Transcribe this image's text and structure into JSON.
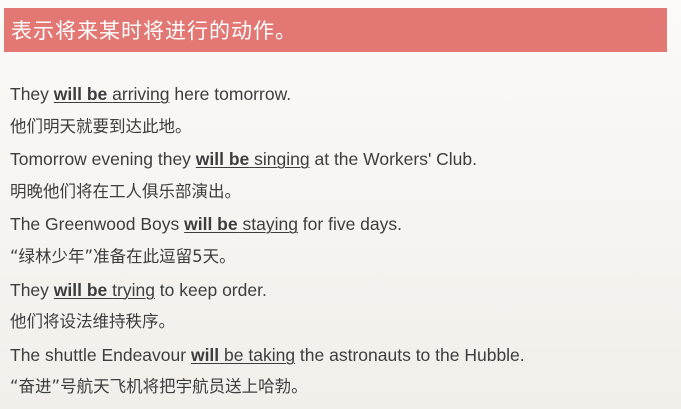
{
  "header": {
    "title": "表示将来某时将进行的动作。"
  },
  "examples": [
    {
      "en": {
        "before": "They ",
        "aux": "will be",
        "mid": " ",
        "verb": "arriving",
        "after": " here tomorrow."
      },
      "cn": "他们明天就要到达此地。"
    },
    {
      "en": {
        "before": "Tomorrow evening they ",
        "aux": "will be",
        "mid": " ",
        "verb": "singing",
        "after": " at the Workers' Club."
      },
      "cn": "明晚他们将在工人俱乐部演出。"
    },
    {
      "en": {
        "before": "The Greenwood Boys ",
        "aux": "will be",
        "mid": " ",
        "verb": "staying",
        "after": " for five days."
      },
      "cn": "“绿林少年”准备在此逗留5天。"
    },
    {
      "en": {
        "before": "They ",
        "aux": "will be",
        "mid": " ",
        "verb": "trying",
        "after": " to keep order."
      },
      "cn": "他们将设法维持秩序。"
    },
    {
      "en": {
        "before": "The shuttle Endeavour ",
        "aux": "will",
        "mid": " ",
        "verb": "be taking",
        "after": " the astronauts to the Hubble."
      },
      "cn": "“奋进”号航天飞机将把宇航员送上哈勃。"
    }
  ],
  "colors": {
    "header_bg": "#e27773",
    "header_text": "#ffffff",
    "body_text": "#3d3d3d"
  }
}
